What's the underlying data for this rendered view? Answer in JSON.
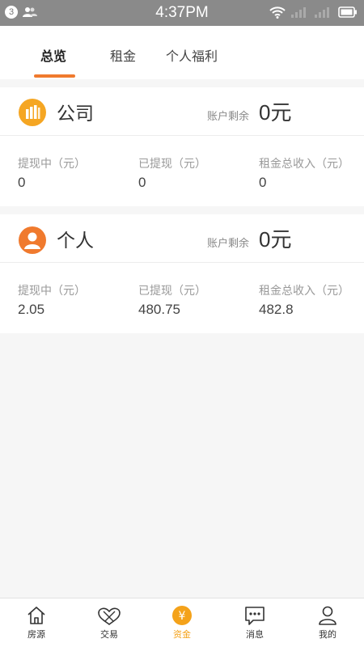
{
  "status_bar": {
    "notification_count": "3",
    "time": "4:37PM"
  },
  "tabs": [
    {
      "label": "总览",
      "active": true
    },
    {
      "label": "租金",
      "active": false
    },
    {
      "label": "个人福利",
      "active": false
    }
  ],
  "company": {
    "title": "公司",
    "balance_label": "账户剩余",
    "balance_value": "0元",
    "stats": [
      {
        "label": "提现中（元）",
        "value": "0"
      },
      {
        "label": "已提现（元）",
        "value": "0"
      },
      {
        "label": "租金总收入（元）",
        "value": "0"
      }
    ]
  },
  "personal": {
    "title": "个人",
    "balance_label": "账户剩余",
    "balance_value": "0元",
    "stats": [
      {
        "label": "提现中（元）",
        "value": "2.05"
      },
      {
        "label": "已提现（元）",
        "value": "480.75"
      },
      {
        "label": "租金总收入（元）",
        "value": "482.8"
      }
    ]
  },
  "bottom_nav": [
    {
      "label": "房源",
      "icon": "house-icon",
      "active": false
    },
    {
      "label": "交易",
      "icon": "handshake-icon",
      "active": false
    },
    {
      "label": "资金",
      "icon": "yen-coin-icon",
      "active": true
    },
    {
      "label": "消息",
      "icon": "message-icon",
      "active": false
    },
    {
      "label": "我的",
      "icon": "person-icon",
      "active": false
    }
  ],
  "colors": {
    "accent": "#f07a2e",
    "active_nav": "#f4a21a",
    "status_bar": "#8a8a8a"
  }
}
